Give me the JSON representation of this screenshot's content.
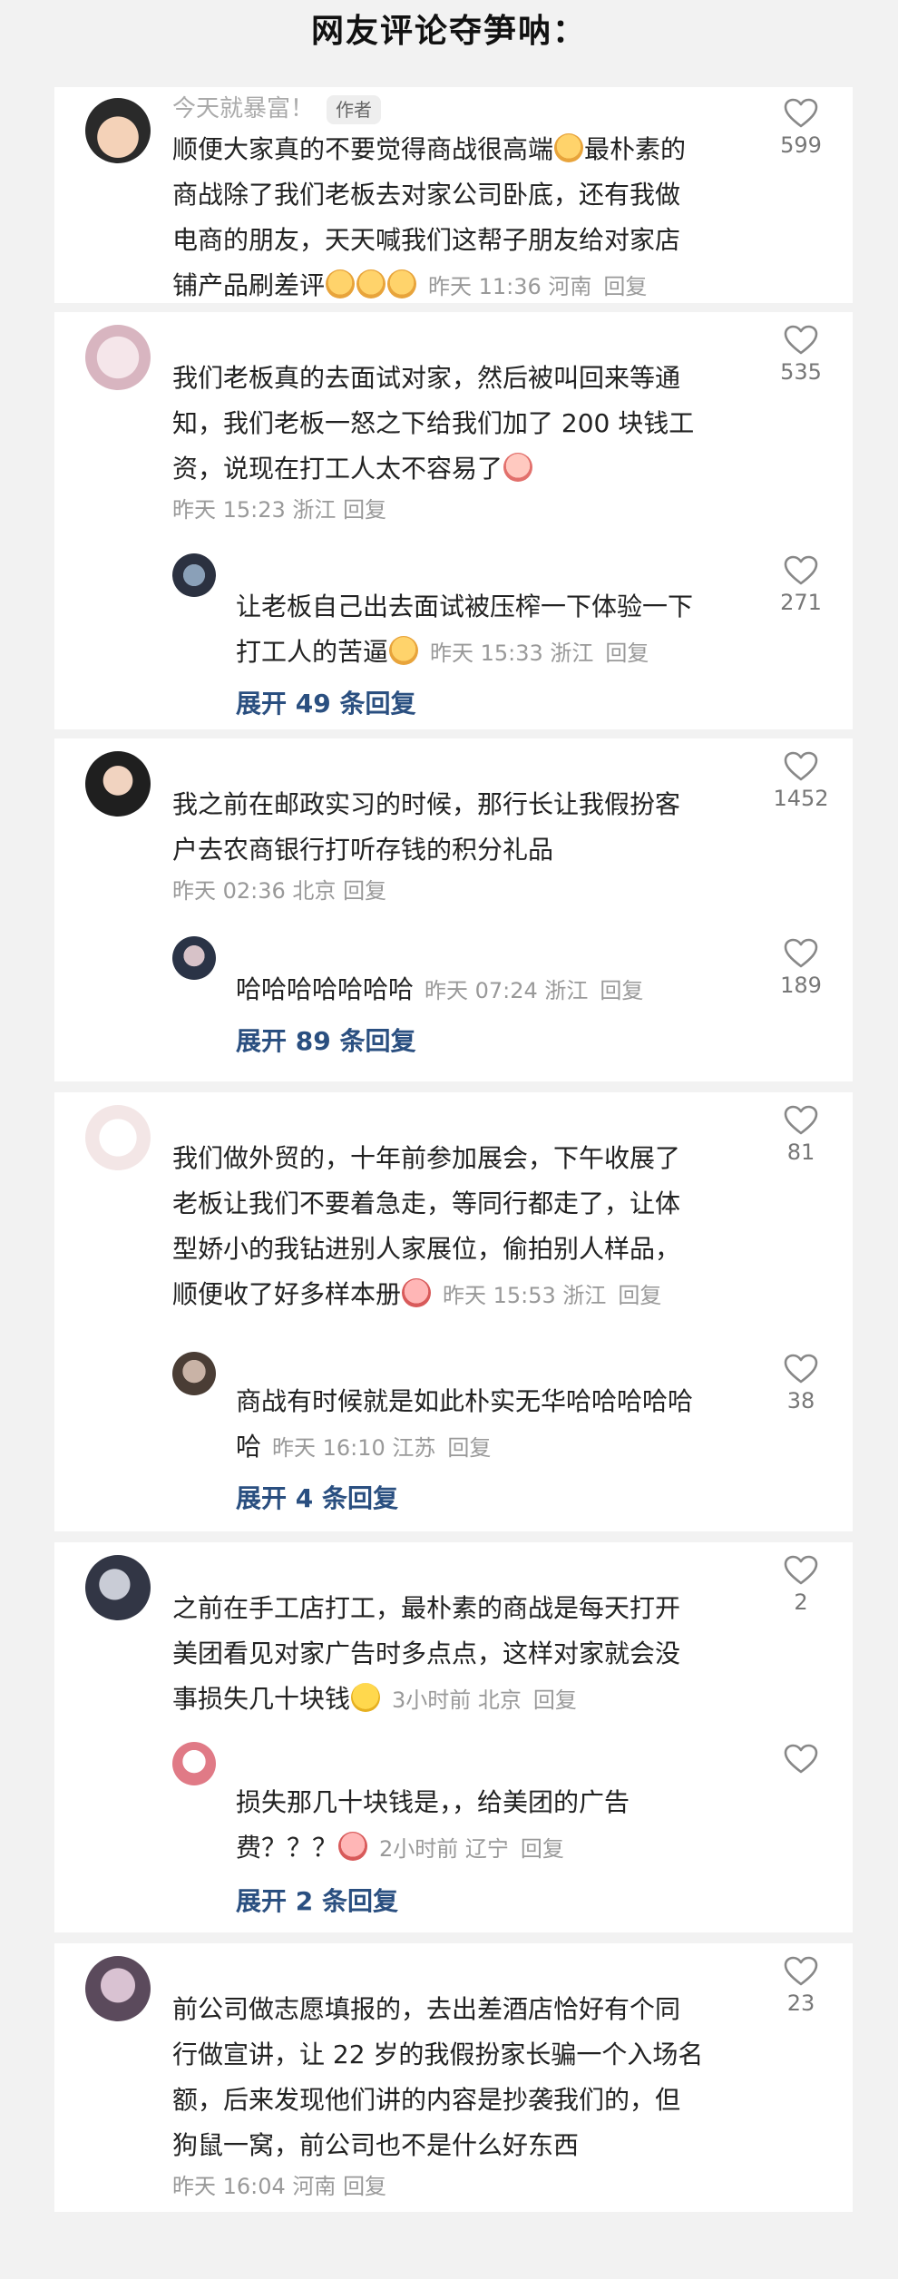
{
  "header": {
    "title": "网友评论夺笋呐："
  },
  "cards": [
    {
      "main": {
        "name": "今天就暴富！",
        "tag": "作者",
        "lines": [
          "顺便大家真的不要觉得商战很高端",
          "最朴素的",
          "商战除了我们老板去对家公司卧底，还有我做",
          "电商的朋友，天天喊我们这帮子朋友给对家店",
          "铺产品刷差评"
        ],
        "meta": "昨天 11:36 河南",
        "reply": "回复",
        "likes": "599"
      }
    },
    {
      "main": {
        "lines": [
          "我们老板真的去面试对家，然后被叫回来等通",
          "知，我们老板一怒之下给我们加了 200 块钱工",
          "资，说现在打工人太不容易了"
        ],
        "meta": "昨天 15:23 浙江",
        "reply": "回复",
        "likes": "535"
      },
      "sub": {
        "lines": [
          "让老板自己出去面试被压榨一下体验一下",
          "打工人的苦逼"
        ],
        "meta": "昨天 15:33 浙江",
        "reply": "回复",
        "likes": "271"
      },
      "expand": "展开 49 条回复"
    },
    {
      "main": {
        "lines": [
          "我之前在邮政实习的时候，那行长让我假扮客",
          "户去农商银行打听存钱的积分礼品"
        ],
        "meta": "昨天 02:36 北京",
        "reply": "回复",
        "likes": "1452"
      },
      "sub": {
        "lines": [
          "哈哈哈哈哈哈哈"
        ],
        "meta": "昨天 07:24 浙江",
        "reply": "回复",
        "likes": "189"
      },
      "expand": "展开 89 条回复"
    },
    {
      "main": {
        "lines": [
          "我们做外贸的，十年前参加展会，下午收展了",
          "老板让我们不要着急走，等同行都走了，让体",
          "型娇小的我钻进别人家展位，偷拍别人样品，",
          "顺便收了好多样本册"
        ],
        "meta": "昨天 15:53 浙江",
        "reply": "回复",
        "likes": "81"
      },
      "sub": {
        "lines": [
          "商战有时候就是如此朴实无华哈哈哈哈哈",
          "哈"
        ],
        "meta": "昨天 16:10 江苏",
        "reply": "回复",
        "likes": "38"
      },
      "expand": "展开 4 条回复"
    },
    {
      "main": {
        "lines": [
          "之前在手工店打工，最朴素的商战是每天打开",
          "美团看见对家广告时多点点，这样对家就会没",
          "事损失几十块钱"
        ],
        "meta": "3小时前 北京",
        "reply": "回复",
        "likes": "2"
      },
      "sub": {
        "lines": [
          "损失那几十块钱是，，给美团的广告",
          "费？？？"
        ],
        "meta": "2小时前 辽宁",
        "reply": "回复",
        "likes": ""
      },
      "expand": "展开 2 条回复"
    },
    {
      "main": {
        "lines": [
          "前公司做志愿填报的，去出差酒店恰好有个同",
          "行做宣讲，让 22 岁的我假扮家长骗一个入场名",
          "额，后来发现他们讲的内容是抄袭我们的，但",
          "狗鼠一窝，前公司也不是什么好东西"
        ],
        "meta": "昨天 16:04 河南",
        "reply": "回复",
        "likes": "23"
      }
    }
  ],
  "icons": {
    "heart": "heart-outline-icon",
    "emoji_doge": "doge-emoji-icon",
    "emoji_cry": "crying-emoji-icon",
    "emoji_weary": "weary-emoji-icon",
    "emoji_scream": "screaming-emoji-icon"
  },
  "colors": {
    "expand_link": "#2a4f80",
    "meta_text": "#999999",
    "page_bg": "#f2f2f2"
  }
}
